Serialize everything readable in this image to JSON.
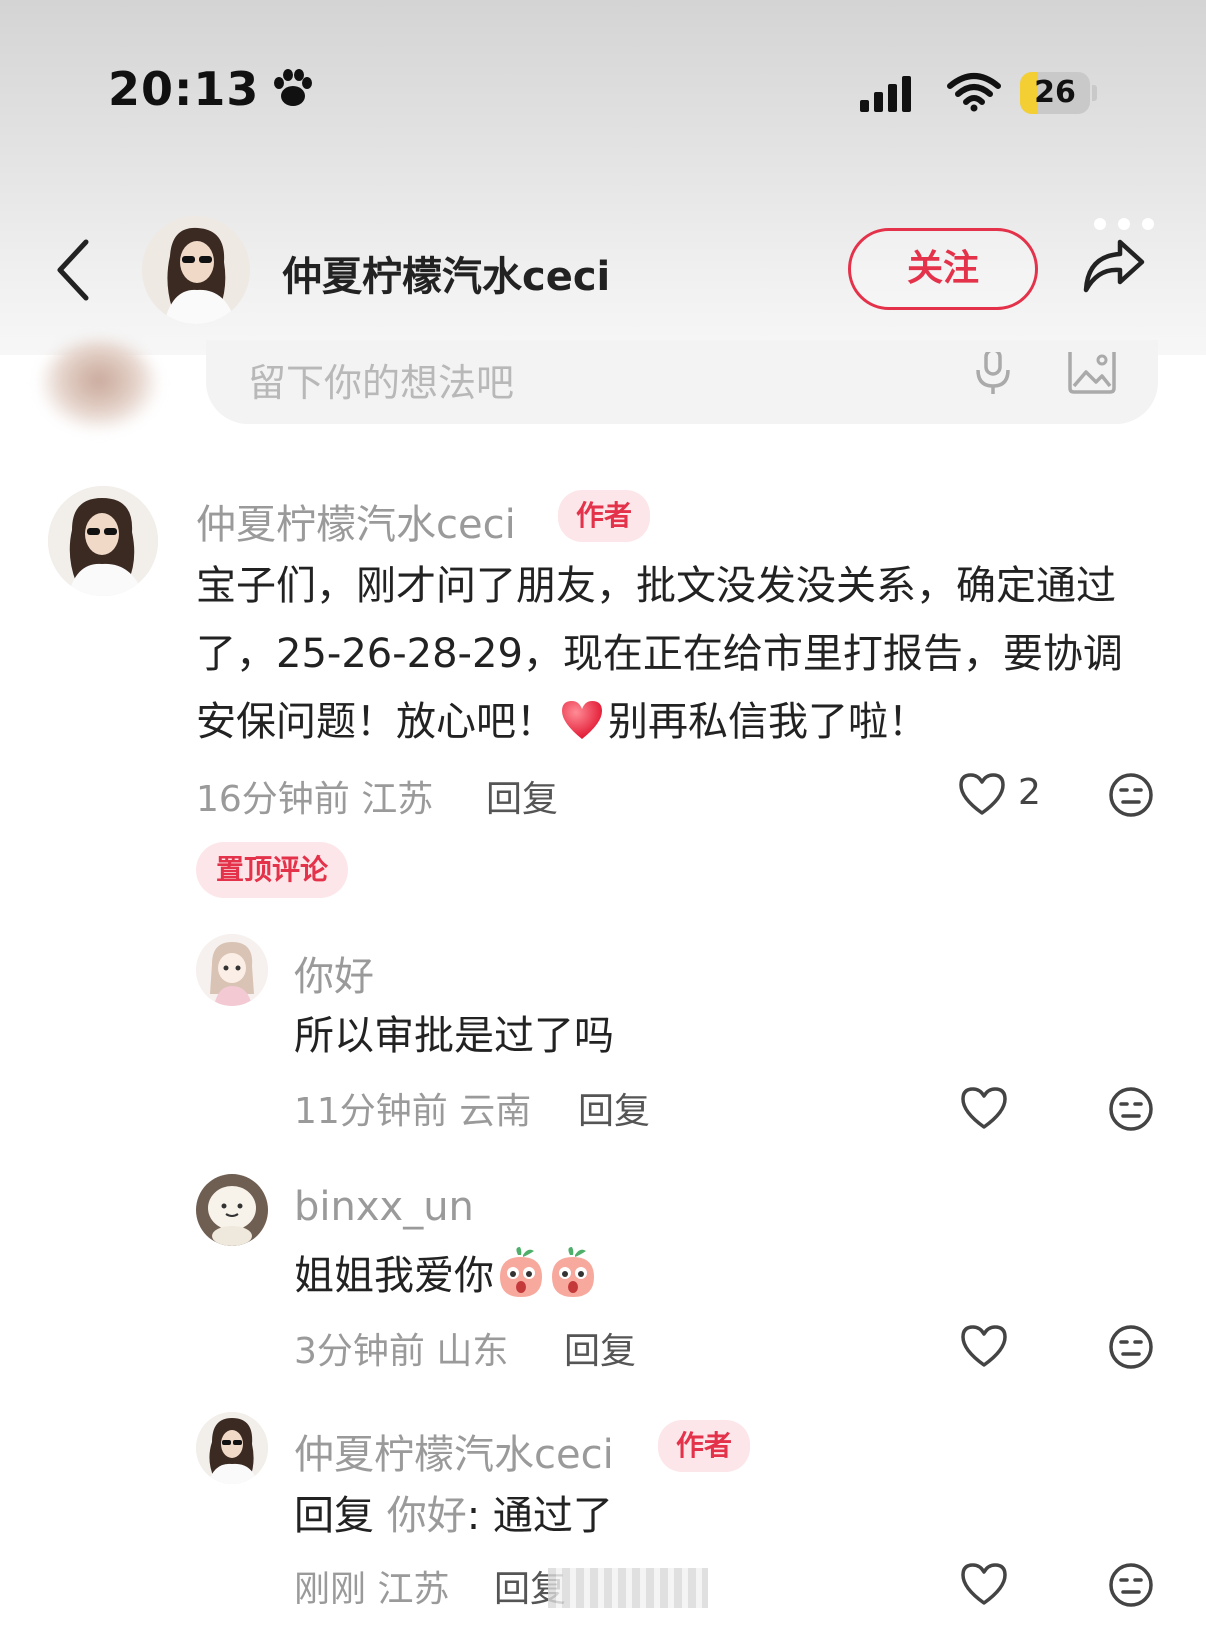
{
  "status_bar": {
    "time": "20:13",
    "battery_level": "26",
    "battery_percent": 26
  },
  "header": {
    "title": "仲夏柠檬汽水ceci",
    "follow_label": "关注"
  },
  "comment_input": {
    "placeholder": "留下你的想法吧"
  },
  "comments": [
    {
      "username": "仲夏柠檬汽水ceci",
      "badge": "作者",
      "text_part1": "宝子们，刚才问了朋友，批文没发没关系，确定通过了，25-26-28-29，现在正在给市里打报告，要协调安保问题！放心吧！",
      "text_part2": "别再私信我了啦！",
      "time": "16分钟前",
      "location": "江苏",
      "reply_label": "回复",
      "likes": "2",
      "pinned_label": "置顶评论"
    }
  ],
  "replies": [
    {
      "username": "你好",
      "text": "所以审批是过了吗",
      "time": "11分钟前",
      "location": "云南",
      "reply_label": "回复"
    },
    {
      "username": "binxx_un",
      "text": "姐姐我爱你",
      "time": "3分钟前",
      "location": "山东",
      "reply_label": "回复"
    },
    {
      "username": "仲夏柠檬汽水ceci",
      "badge": "作者",
      "reply_prefix": "回复",
      "reply_to": "你好",
      "text": ": 通过了",
      "time": "刚刚",
      "location": "江苏",
      "reply_label": "回复"
    }
  ],
  "colors": {
    "accent": "#e3324a",
    "badge_bg": "#fde6e9",
    "muted_text": "#9a9a9a",
    "battery_fill": "#f3cf34"
  },
  "icons": [
    "paw-icon",
    "signal-icon",
    "wifi-icon",
    "back-icon",
    "more-icon",
    "share-icon",
    "mic-icon",
    "image-icon",
    "heart-icon",
    "emoji-icon"
  ]
}
